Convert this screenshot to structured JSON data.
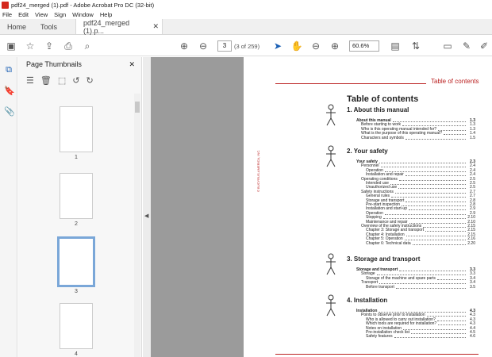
{
  "window": {
    "title": "pdf24_merged (1).pdf - Adobe Acrobat Pro DC (32-bit)"
  },
  "menu": [
    "File",
    "Edit",
    "View",
    "Sign",
    "Window",
    "Help"
  ],
  "tabs": {
    "home": "Home",
    "tools": "Tools",
    "doc": "pdf24_merged (1).p..."
  },
  "nav": {
    "page": "3",
    "count": "(3 of 259)",
    "zoom": "60.6%"
  },
  "panel": {
    "title": "Page Thumbnails",
    "thumbs": [
      "1",
      "2",
      "3",
      "4"
    ]
  },
  "doc": {
    "header": "Table of contents",
    "title": "Table of contents",
    "vertical": "© BUCYRUS-AMERICA, INC.",
    "sections": [
      {
        "title": "1. About this manual",
        "entries": [
          [
            "Before starting to work",
            "1.3"
          ],
          [
            "Who is this operating manual intended for?",
            "1.3"
          ],
          [
            "What is the purpose of this operating manual?",
            "1.4"
          ],
          [
            "Characters and symbols",
            "1.5"
          ]
        ],
        "head": [
          "About this manual",
          "1.3"
        ]
      },
      {
        "title": "2. Your safety",
        "head": [
          "Your safety",
          "2.3"
        ],
        "entries": [
          [
            "Personnel",
            "2.4"
          ],
          [
            "Operation",
            "2.4"
          ],
          [
            "Installation and repair",
            "2.4"
          ],
          [
            "Operating conditions",
            "2.5"
          ],
          [
            "Intended use",
            "2.5"
          ],
          [
            "Unauthorized use",
            "2.5"
          ],
          [
            "Safety instructions",
            "2.7"
          ],
          [
            "General rules",
            "2.7"
          ],
          [
            "Storage and transport",
            "2.8"
          ],
          [
            "Pre-start inspection",
            "2.8"
          ],
          [
            "Installation and start-up",
            "2.9"
          ],
          [
            "Operation",
            "2.9"
          ],
          [
            "Stopping",
            "2.10"
          ],
          [
            "Maintenance and repair",
            "2.10"
          ],
          [
            "Overview of the safety instructions",
            "2.15"
          ],
          [
            "Chapter 3: Storage and transport",
            "2.15"
          ],
          [
            "Chapter 4: Installation",
            "2.15"
          ],
          [
            "Chapter 5: Operation",
            "2.16"
          ],
          [
            "Chapter 6: Technical data",
            "2.20"
          ]
        ]
      },
      {
        "title": "3. Storage and transport",
        "head": [
          "Storage and transport",
          "3.3"
        ],
        "entries": [
          [
            "Storage",
            "3.3"
          ],
          [
            "Storage of the machine and spare parts",
            "3.4"
          ],
          [
            "Transport",
            "3.4"
          ],
          [
            "Before transport",
            "3.5"
          ]
        ]
      },
      {
        "title": "4. Installation",
        "head": [
          "Installation",
          "4.3"
        ],
        "entries": [
          [
            "Points to observe prior to installation",
            "4.3"
          ],
          [
            "Who is allowed to carry out installation?",
            "4.3"
          ],
          [
            "Which tools are required for installation?",
            "4.3"
          ],
          [
            "Notes on installation",
            "4.4"
          ],
          [
            "Pre-installation check list",
            "4.5"
          ],
          [
            "Safety features",
            "4.6"
          ]
        ]
      }
    ]
  },
  "colors": {
    "accent": "#b22222",
    "selected": "#7aa7d8"
  }
}
